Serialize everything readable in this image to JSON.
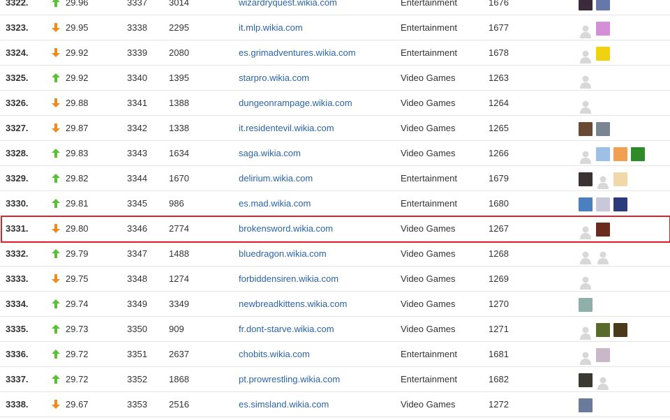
{
  "colors": {
    "link": "#2b64a6",
    "arrow_up": "#55c233",
    "arrow_down": "#f08a1c",
    "highlight_border": "#e0212e",
    "row_border": "#e3e3e3"
  },
  "highlighted_rank": "3331.",
  "rows": [
    {
      "rank": "3322.",
      "trend": "up",
      "score": "29.96",
      "prev": "3337",
      "views": "3014",
      "url": "wizardryquest.wikia.com",
      "category": "Entertainment",
      "cat_rank": "1676",
      "avatars": [
        {
          "kind": "photo",
          "color": "#3a2a3a"
        },
        {
          "kind": "photo",
          "color": "#6677aa"
        }
      ]
    },
    {
      "rank": "3323.",
      "trend": "down",
      "score": "29.95",
      "prev": "3338",
      "views": "2295",
      "url": "it.mlp.wikia.com",
      "category": "Entertainment",
      "cat_rank": "1677",
      "avatars": [
        {
          "kind": "placeholder"
        },
        {
          "kind": "photo",
          "color": "#d58fd8"
        }
      ]
    },
    {
      "rank": "3324.",
      "trend": "down",
      "score": "29.92",
      "prev": "3339",
      "views": "2080",
      "url": "es.grimadventures.wikia.com",
      "category": "Entertainment",
      "cat_rank": "1678",
      "avatars": [
        {
          "kind": "placeholder"
        },
        {
          "kind": "photo",
          "color": "#f1d20f"
        }
      ]
    },
    {
      "rank": "3325.",
      "trend": "up",
      "score": "29.92",
      "prev": "3340",
      "views": "1395",
      "url": "starpro.wikia.com",
      "category": "Video Games",
      "cat_rank": "1263",
      "avatars": [
        {
          "kind": "placeholder"
        }
      ]
    },
    {
      "rank": "3326.",
      "trend": "down",
      "score": "29.88",
      "prev": "3341",
      "views": "1388",
      "url": "dungeonrampage.wikia.com",
      "category": "Video Games",
      "cat_rank": "1264",
      "avatars": [
        {
          "kind": "placeholder"
        }
      ]
    },
    {
      "rank": "3327.",
      "trend": "down",
      "score": "29.87",
      "prev": "3342",
      "views": "1338",
      "url": "it.residentevil.wikia.com",
      "category": "Video Games",
      "cat_rank": "1265",
      "avatars": [
        {
          "kind": "photo",
          "color": "#6b4a35"
        },
        {
          "kind": "photo",
          "color": "#7a8594"
        }
      ]
    },
    {
      "rank": "3328.",
      "trend": "up",
      "score": "29.83",
      "prev": "3343",
      "views": "1634",
      "url": "saga.wikia.com",
      "category": "Video Games",
      "cat_rank": "1266",
      "avatars": [
        {
          "kind": "placeholder"
        },
        {
          "kind": "photo",
          "color": "#9ec0e6"
        },
        {
          "kind": "photo",
          "color": "#f0a050"
        },
        {
          "kind": "photo",
          "color": "#2f8a2a"
        }
      ]
    },
    {
      "rank": "3329.",
      "trend": "up",
      "score": "29.82",
      "prev": "3344",
      "views": "1670",
      "url": "delirium.wikia.com",
      "category": "Entertainment",
      "cat_rank": "1679",
      "avatars": [
        {
          "kind": "photo",
          "color": "#3b3232"
        },
        {
          "kind": "placeholder"
        },
        {
          "kind": "photo",
          "color": "#f0d8a8"
        }
      ]
    },
    {
      "rank": "3330.",
      "trend": "up",
      "score": "29.81",
      "prev": "3345",
      "views": "986",
      "url": "es.mad.wikia.com",
      "category": "Entertainment",
      "cat_rank": "1680",
      "avatars": [
        {
          "kind": "photo",
          "color": "#4a7fc0"
        },
        {
          "kind": "photo",
          "color": "#c8c8d8"
        },
        {
          "kind": "photo",
          "color": "#2a3a7a"
        }
      ]
    },
    {
      "rank": "3331.",
      "trend": "down",
      "score": "29.80",
      "prev": "3346",
      "views": "2774",
      "url": "brokensword.wikia.com",
      "category": "Video Games",
      "cat_rank": "1267",
      "avatars": [
        {
          "kind": "placeholder"
        },
        {
          "kind": "photo",
          "color": "#6a2a1e"
        }
      ]
    },
    {
      "rank": "3332.",
      "trend": "up",
      "score": "29.79",
      "prev": "3347",
      "views": "1488",
      "url": "bluedragon.wikia.com",
      "category": "Video Games",
      "cat_rank": "1268",
      "avatars": [
        {
          "kind": "placeholder"
        },
        {
          "kind": "placeholder"
        }
      ]
    },
    {
      "rank": "3333.",
      "trend": "down",
      "score": "29.75",
      "prev": "3348",
      "views": "1274",
      "url": "forbiddensiren.wikia.com",
      "category": "Video Games",
      "cat_rank": "1269",
      "avatars": [
        {
          "kind": "placeholder"
        }
      ]
    },
    {
      "rank": "3334.",
      "trend": "up",
      "score": "29.74",
      "prev": "3349",
      "views": "3349",
      "url": "newbreadkittens.wikia.com",
      "category": "Video Games",
      "cat_rank": "1270",
      "avatars": [
        {
          "kind": "photo",
          "color": "#8fb0a8"
        }
      ]
    },
    {
      "rank": "3335.",
      "trend": "up",
      "score": "29.73",
      "prev": "3350",
      "views": "909",
      "url": "fr.dont-starve.wikia.com",
      "category": "Video Games",
      "cat_rank": "1271",
      "avatars": [
        {
          "kind": "placeholder"
        },
        {
          "kind": "photo",
          "color": "#5a6a2a"
        },
        {
          "kind": "photo",
          "color": "#4a3a1a"
        }
      ]
    },
    {
      "rank": "3336.",
      "trend": "up",
      "score": "29.72",
      "prev": "3351",
      "views": "2637",
      "url": "chobits.wikia.com",
      "category": "Entertainment",
      "cat_rank": "1681",
      "avatars": [
        {
          "kind": "placeholder"
        },
        {
          "kind": "photo",
          "color": "#c8b8c8"
        }
      ]
    },
    {
      "rank": "3337.",
      "trend": "up",
      "score": "29.72",
      "prev": "3352",
      "views": "1868",
      "url": "pt.prowrestling.wikia.com",
      "category": "Entertainment",
      "cat_rank": "1682",
      "avatars": [
        {
          "kind": "photo",
          "color": "#3a3a32"
        },
        {
          "kind": "placeholder"
        }
      ]
    },
    {
      "rank": "3338.",
      "trend": "down",
      "score": "29.67",
      "prev": "3353",
      "views": "2516",
      "url": "es.simsland.wikia.com",
      "category": "Video Games",
      "cat_rank": "1272",
      "avatars": [
        {
          "kind": "photo",
          "color": "#6a7a9a"
        }
      ]
    }
  ]
}
